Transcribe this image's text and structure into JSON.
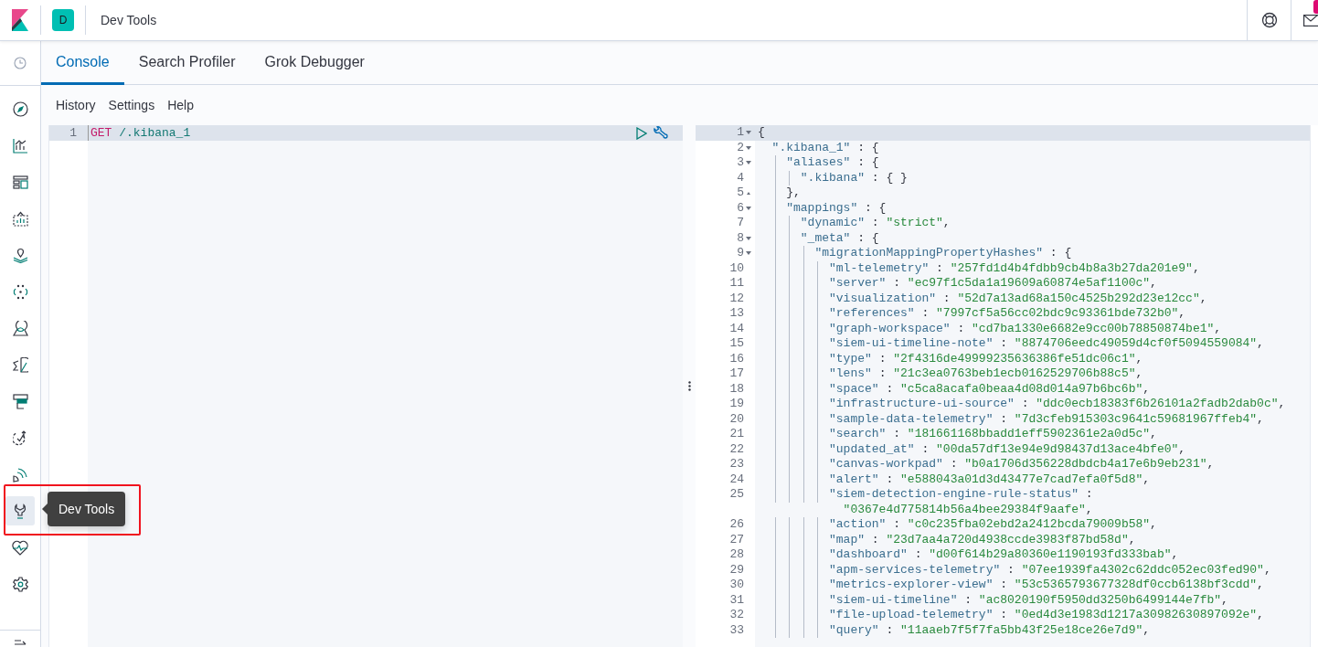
{
  "header": {
    "avatar": "D",
    "breadcrumb": "Dev Tools"
  },
  "nav_items": [
    {
      "selected": false
    },
    {
      "selected": false
    },
    {
      "selected": false
    },
    {
      "selected": false
    },
    {
      "selected": false
    },
    {
      "selected": false
    },
    {
      "selected": false
    },
    {
      "selected": false
    },
    {
      "selected": false
    },
    {
      "selected": false
    },
    {
      "selected": false
    },
    {
      "selected": true
    },
    {
      "selected": false
    },
    {
      "selected": false
    }
  ],
  "tooltip": "Dev Tools",
  "tabs": [
    {
      "label": "Console",
      "selected": true
    },
    {
      "label": "Search Profiler",
      "selected": false
    },
    {
      "label": "Grok Debugger",
      "selected": false
    }
  ],
  "menu": [
    "History",
    "Settings",
    "Help"
  ],
  "request": {
    "lines": [
      {
        "number": "1",
        "method": "GET",
        "path": " /.kibana_1"
      }
    ]
  },
  "response": {
    "lines": [
      {
        "number": "1",
        "fold_start": true,
        "fold_end": false,
        "code": [
          {
            "kind": "punct",
            "text": "{"
          }
        ]
      },
      {
        "number": "2",
        "fold_start": true,
        "fold_end": false,
        "code": [
          {
            "kind": "key",
            "text": "  \".kibana_1\""
          },
          {
            "kind": "punct",
            "text": " : {"
          }
        ]
      },
      {
        "number": "3",
        "fold_start": true,
        "fold_end": false,
        "code": [
          {
            "kind": "key",
            "text": "    \"aliases\""
          },
          {
            "kind": "punct",
            "text": " : {"
          }
        ]
      },
      {
        "number": "4",
        "fold_start": false,
        "fold_end": false,
        "code": [
          {
            "kind": "key",
            "text": "      \".kibana\""
          },
          {
            "kind": "punct",
            "text": " : { }"
          }
        ]
      },
      {
        "number": "5",
        "fold_start": false,
        "fold_end": true,
        "code": [
          {
            "kind": "punct",
            "text": "    },"
          }
        ]
      },
      {
        "number": "6",
        "fold_start": true,
        "fold_end": false,
        "code": [
          {
            "kind": "key",
            "text": "    \"mappings\""
          },
          {
            "kind": "punct",
            "text": " : {"
          }
        ]
      },
      {
        "number": "7",
        "fold_start": false,
        "fold_end": false,
        "code": [
          {
            "kind": "key",
            "text": "      \"dynamic\""
          },
          {
            "kind": "punct",
            "text": " : "
          },
          {
            "kind": "string",
            "text": "\"strict\""
          },
          {
            "kind": "punct",
            "text": ","
          }
        ]
      },
      {
        "number": "8",
        "fold_start": true,
        "fold_end": false,
        "code": [
          {
            "kind": "key",
            "text": "      \"_meta\""
          },
          {
            "kind": "punct",
            "text": " : {"
          }
        ]
      },
      {
        "number": "9",
        "fold_start": true,
        "fold_end": false,
        "code": [
          {
            "kind": "key",
            "text": "        \"migrationMappingPropertyHashes\""
          },
          {
            "kind": "punct",
            "text": " : {"
          }
        ]
      },
      {
        "number": "10",
        "fold_start": false,
        "fold_end": false,
        "code": [
          {
            "kind": "key",
            "text": "          \"ml-telemetry\""
          },
          {
            "kind": "punct",
            "text": " : "
          },
          {
            "kind": "string",
            "text": "\"257fd1d4b4fdbb9cb4b8a3b27da201e9\""
          },
          {
            "kind": "punct",
            "text": ","
          }
        ]
      },
      {
        "number": "11",
        "fold_start": false,
        "fold_end": false,
        "code": [
          {
            "kind": "key",
            "text": "          \"server\""
          },
          {
            "kind": "punct",
            "text": " : "
          },
          {
            "kind": "string",
            "text": "\"ec97f1c5da1a19609a60874e5af1100c\""
          },
          {
            "kind": "punct",
            "text": ","
          }
        ]
      },
      {
        "number": "12",
        "fold_start": false,
        "fold_end": false,
        "code": [
          {
            "kind": "key",
            "text": "          \"visualization\""
          },
          {
            "kind": "punct",
            "text": " : "
          },
          {
            "kind": "string",
            "text": "\"52d7a13ad68a150c4525b292d23e12cc\""
          },
          {
            "kind": "punct",
            "text": ","
          }
        ]
      },
      {
        "number": "13",
        "fold_start": false,
        "fold_end": false,
        "code": [
          {
            "kind": "key",
            "text": "          \"references\""
          },
          {
            "kind": "punct",
            "text": " : "
          },
          {
            "kind": "string",
            "text": "\"7997cf5a56cc02bdc9c93361bde732b0\""
          },
          {
            "kind": "punct",
            "text": ","
          }
        ]
      },
      {
        "number": "14",
        "fold_start": false,
        "fold_end": false,
        "code": [
          {
            "kind": "key",
            "text": "          \"graph-workspace\""
          },
          {
            "kind": "punct",
            "text": " : "
          },
          {
            "kind": "string",
            "text": "\"cd7ba1330e6682e9cc00b78850874be1\""
          },
          {
            "kind": "punct",
            "text": ","
          }
        ]
      },
      {
        "number": "15",
        "fold_start": false,
        "fold_end": false,
        "code": [
          {
            "kind": "key",
            "text": "          \"siem-ui-timeline-note\""
          },
          {
            "kind": "punct",
            "text": " : "
          },
          {
            "kind": "string",
            "text": "\"8874706eedc49059d4cf0f5094559084\""
          },
          {
            "kind": "punct",
            "text": ","
          }
        ]
      },
      {
        "number": "16",
        "fold_start": false,
        "fold_end": false,
        "code": [
          {
            "kind": "key",
            "text": "          \"type\""
          },
          {
            "kind": "punct",
            "text": " : "
          },
          {
            "kind": "string",
            "text": "\"2f4316de49999235636386fe51dc06c1\""
          },
          {
            "kind": "punct",
            "text": ","
          }
        ]
      },
      {
        "number": "17",
        "fold_start": false,
        "fold_end": false,
        "code": [
          {
            "kind": "key",
            "text": "          \"lens\""
          },
          {
            "kind": "punct",
            "text": " : "
          },
          {
            "kind": "string",
            "text": "\"21c3ea0763beb1ecb0162529706b88c5\""
          },
          {
            "kind": "punct",
            "text": ","
          }
        ]
      },
      {
        "number": "18",
        "fold_start": false,
        "fold_end": false,
        "code": [
          {
            "kind": "key",
            "text": "          \"space\""
          },
          {
            "kind": "punct",
            "text": " : "
          },
          {
            "kind": "string",
            "text": "\"c5ca8acafa0beaa4d08d014a97b6bc6b\""
          },
          {
            "kind": "punct",
            "text": ","
          }
        ]
      },
      {
        "number": "19",
        "fold_start": false,
        "fold_end": false,
        "code": [
          {
            "kind": "key",
            "text": "          \"infrastructure-ui-source\""
          },
          {
            "kind": "punct",
            "text": " : "
          },
          {
            "kind": "string",
            "text": "\"ddc0ecb18383f6b26101a2fadb2dab0c\""
          },
          {
            "kind": "punct",
            "text": ","
          }
        ]
      },
      {
        "number": "20",
        "fold_start": false,
        "fold_end": false,
        "code": [
          {
            "kind": "key",
            "text": "          \"sample-data-telemetry\""
          },
          {
            "kind": "punct",
            "text": " : "
          },
          {
            "kind": "string",
            "text": "\"7d3cfeb915303c9641c59681967ffeb4\""
          },
          {
            "kind": "punct",
            "text": ","
          }
        ]
      },
      {
        "number": "21",
        "fold_start": false,
        "fold_end": false,
        "code": [
          {
            "kind": "key",
            "text": "          \"search\""
          },
          {
            "kind": "punct",
            "text": " : "
          },
          {
            "kind": "string",
            "text": "\"181661168bbadd1eff5902361e2a0d5c\""
          },
          {
            "kind": "punct",
            "text": ","
          }
        ]
      },
      {
        "number": "22",
        "fold_start": false,
        "fold_end": false,
        "code": [
          {
            "kind": "key",
            "text": "          \"updated_at\""
          },
          {
            "kind": "punct",
            "text": " : "
          },
          {
            "kind": "string",
            "text": "\"00da57df13e94e9d98437d13ace4bfe0\""
          },
          {
            "kind": "punct",
            "text": ","
          }
        ]
      },
      {
        "number": "23",
        "fold_start": false,
        "fold_end": false,
        "code": [
          {
            "kind": "key",
            "text": "          \"canvas-workpad\""
          },
          {
            "kind": "punct",
            "text": " : "
          },
          {
            "kind": "string",
            "text": "\"b0a1706d356228dbdcb4a17e6b9eb231\""
          },
          {
            "kind": "punct",
            "text": ","
          }
        ]
      },
      {
        "number": "24",
        "fold_start": false,
        "fold_end": false,
        "code": [
          {
            "kind": "key",
            "text": "          \"alert\""
          },
          {
            "kind": "punct",
            "text": " : "
          },
          {
            "kind": "string",
            "text": "\"e588043a01d3d43477e7cad7efa0f5d8\""
          },
          {
            "kind": "punct",
            "text": ","
          }
        ]
      },
      {
        "number": "25",
        "fold_start": false,
        "fold_end": false,
        "code": [
          {
            "kind": "key",
            "text": "          \"siem-detection-engine-rule-status\""
          },
          {
            "kind": "punct",
            "text": " :"
          }
        ],
        "wrapped": [
          {
            "kind": "string",
            "text": "            \"0367e4d775814b56a4bee29384f9aafe\""
          },
          {
            "kind": "punct",
            "text": ","
          }
        ]
      },
      {
        "number": "26",
        "fold_start": false,
        "fold_end": false,
        "code": [
          {
            "kind": "key",
            "text": "          \"action\""
          },
          {
            "kind": "punct",
            "text": " : "
          },
          {
            "kind": "string",
            "text": "\"c0c235fba02ebd2a2412bcda79009b58\""
          },
          {
            "kind": "punct",
            "text": ","
          }
        ]
      },
      {
        "number": "27",
        "fold_start": false,
        "fold_end": false,
        "code": [
          {
            "kind": "key",
            "text": "          \"map\""
          },
          {
            "kind": "punct",
            "text": " : "
          },
          {
            "kind": "string",
            "text": "\"23d7aa4a720d4938ccde3983f87bd58d\""
          },
          {
            "kind": "punct",
            "text": ","
          }
        ]
      },
      {
        "number": "28",
        "fold_start": false,
        "fold_end": false,
        "code": [
          {
            "kind": "key",
            "text": "          \"dashboard\""
          },
          {
            "kind": "punct",
            "text": " : "
          },
          {
            "kind": "string",
            "text": "\"d00f614b29a80360e1190193fd333bab\""
          },
          {
            "kind": "punct",
            "text": ","
          }
        ]
      },
      {
        "number": "29",
        "fold_start": false,
        "fold_end": false,
        "code": [
          {
            "kind": "key",
            "text": "          \"apm-services-telemetry\""
          },
          {
            "kind": "punct",
            "text": " : "
          },
          {
            "kind": "string",
            "text": "\"07ee1939fa4302c62ddc052ec03fed90\""
          },
          {
            "kind": "punct",
            "text": ","
          }
        ]
      },
      {
        "number": "30",
        "fold_start": false,
        "fold_end": false,
        "code": [
          {
            "kind": "key",
            "text": "          \"metrics-explorer-view\""
          },
          {
            "kind": "punct",
            "text": " : "
          },
          {
            "kind": "string",
            "text": "\"53c5365793677328df0ccb6138bf3cdd\""
          },
          {
            "kind": "punct",
            "text": ","
          }
        ]
      },
      {
        "number": "31",
        "fold_start": false,
        "fold_end": false,
        "code": [
          {
            "kind": "key",
            "text": "          \"siem-ui-timeline\""
          },
          {
            "kind": "punct",
            "text": " : "
          },
          {
            "kind": "string",
            "text": "\"ac8020190f5950dd3250b6499144e7fb\""
          },
          {
            "kind": "punct",
            "text": ","
          }
        ]
      },
      {
        "number": "32",
        "fold_start": false,
        "fold_end": false,
        "code": [
          {
            "kind": "key",
            "text": "          \"file-upload-telemetry\""
          },
          {
            "kind": "punct",
            "text": " : "
          },
          {
            "kind": "string",
            "text": "\"0ed4d3e1983d1217a30982630897092e\""
          },
          {
            "kind": "punct",
            "text": ","
          }
        ]
      },
      {
        "number": "33",
        "fold_start": false,
        "fold_end": false,
        "code": [
          {
            "kind": "key",
            "text": "          \"query\""
          },
          {
            "kind": "punct",
            "text": " : "
          },
          {
            "kind": "string",
            "text": "\"11aaeb7f5f7fa5bb43f25e18ce26e7d9\""
          },
          {
            "kind": "punct",
            "text": ","
          }
        ]
      }
    ]
  }
}
